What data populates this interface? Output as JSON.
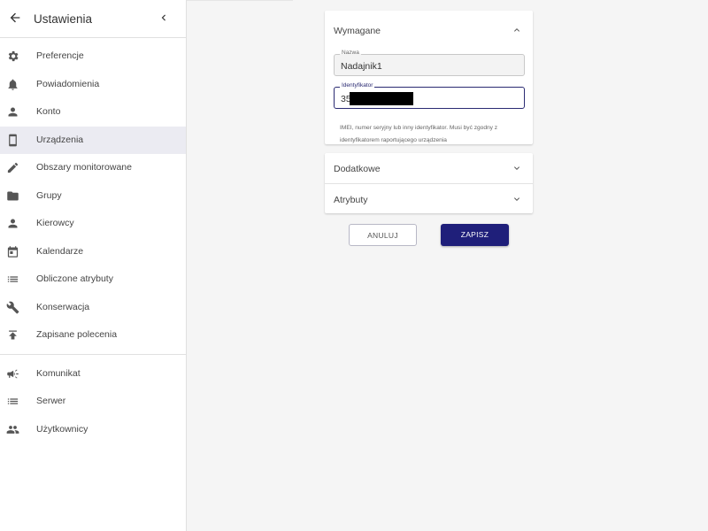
{
  "sidebar": {
    "title": "Ustawienia",
    "items": [
      {
        "label": "Preferencje",
        "icon": "gear-icon"
      },
      {
        "label": "Powiadomienia",
        "icon": "bell-icon"
      },
      {
        "label": "Konto",
        "icon": "person-icon"
      },
      {
        "label": "Urządzenia",
        "icon": "smartphone-icon",
        "active": true
      },
      {
        "label": "Obszary monitorowane",
        "icon": "pencil-icon"
      },
      {
        "label": "Grupy",
        "icon": "folder-icon"
      },
      {
        "label": "Kierowcy",
        "icon": "person-icon"
      },
      {
        "label": "Kalendarze",
        "icon": "calendar-icon"
      },
      {
        "label": "Obliczone atrybuty",
        "icon": "list-icon"
      },
      {
        "label": "Konserwacja",
        "icon": "wrench-icon"
      },
      {
        "label": "Zapisane polecenia",
        "icon": "publish-icon"
      }
    ],
    "admin_items": [
      {
        "label": "Komunikat",
        "icon": "megaphone-icon"
      },
      {
        "label": "Serwer",
        "icon": "server-list-icon"
      },
      {
        "label": "Użytkownicy",
        "icon": "people-icon"
      }
    ]
  },
  "form": {
    "required_title": "Wymagane",
    "name_label": "Nazwa",
    "name_value": "Nadajnik1",
    "identifier_label": "Identyfikator",
    "identifier_value": "35",
    "identifier_help": "IMEI, numer seryjny lub inny identyfikator. Musi być zgodny z identyfikatorem raportującego urządzenia",
    "extra_title": "Dodatkowe",
    "attributes_title": "Atrybuty"
  },
  "actions": {
    "cancel_label": "ANULUJ",
    "save_label": "ZAPISZ"
  },
  "colors": {
    "accent": "#1f1f7a",
    "active_item_bg": "#ebebf2",
    "page_bg": "#f5f5f5"
  }
}
